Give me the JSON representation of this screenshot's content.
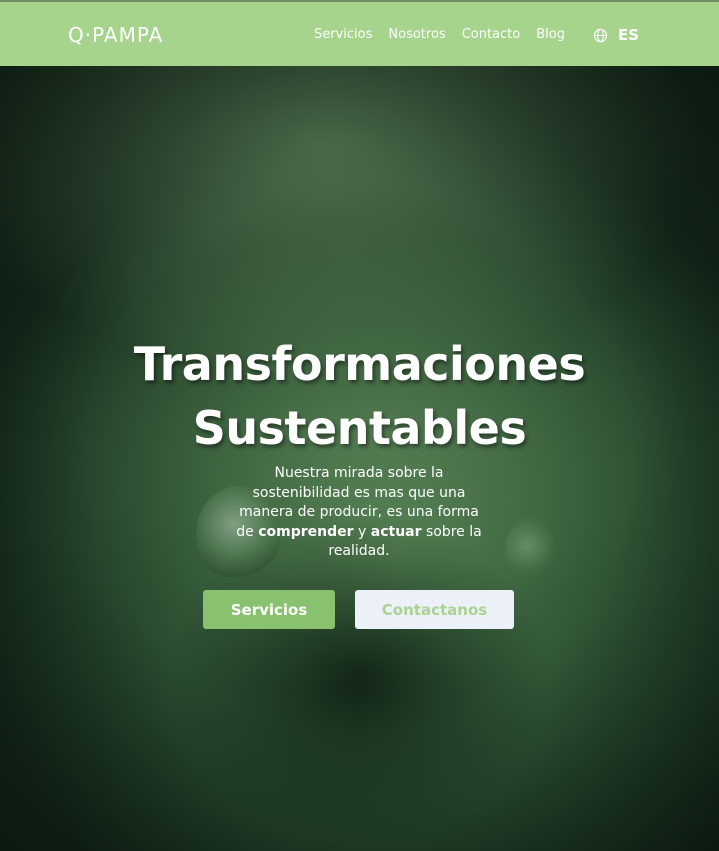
{
  "header": {
    "logo_text": "Q·PAMPA",
    "nav": [
      "Servicios",
      "Nosotros",
      "Contacto",
      "Blog"
    ],
    "language": "ES",
    "globe_icon": "globe-icon"
  },
  "hero": {
    "title_line1": "Transformaciones",
    "title_line2": "Sustentables",
    "text_before": "Nuestra mirada sobre la sostenibilidad es mas que una manera de producir, es una forma de ",
    "bold1": "comprender",
    "text_mid": " y ",
    "bold2": "actuar",
    "text_after": " sobre la realidad.",
    "primary_button": "Servicios",
    "secondary_button": "Contactanos"
  },
  "colors": {
    "navbar": "#a6d48c",
    "primary_button": "#88c26e",
    "secondary_button_bg": "#ecf0f8",
    "secondary_button_text": "#a9d48f"
  }
}
